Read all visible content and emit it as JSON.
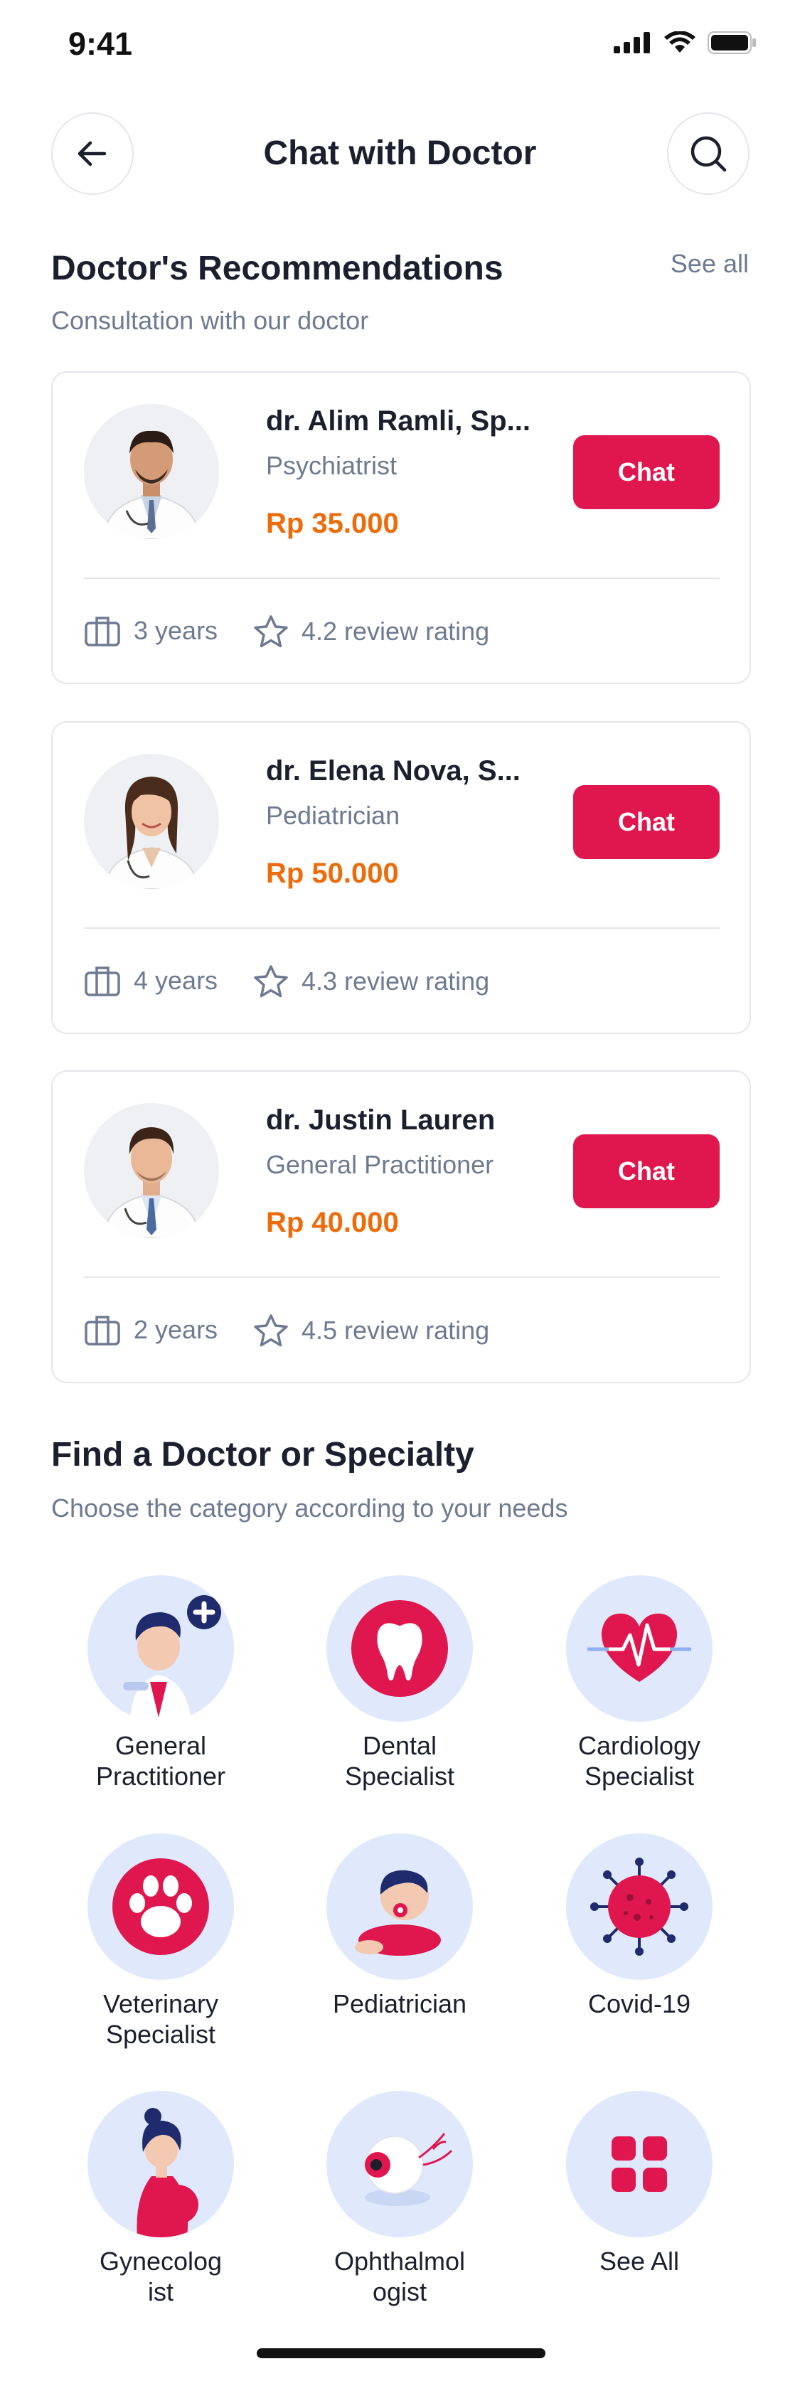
{
  "status_bar": {
    "time": "9:41"
  },
  "header": {
    "title": "Chat with Doctor"
  },
  "recommendations": {
    "title": "Doctor's Recommendations",
    "subtitle": "Consultation with our doctor",
    "see_all": "See all",
    "doctors": [
      {
        "name": "dr. Alim Ramli, Sp...",
        "specialty": "Psychiatrist",
        "price": "Rp 35.000",
        "chat_label": "Chat",
        "experience": "3 years",
        "rating": "4.2 review rating"
      },
      {
        "name": "dr. Elena Nova, S...",
        "specialty": "Pediatrician",
        "price": "Rp 50.000",
        "chat_label": "Chat",
        "experience": "4 years",
        "rating": "4.3 review rating"
      },
      {
        "name": "dr. Justin Lauren",
        "specialty": "General Practitioner",
        "price": "Rp 40.000",
        "chat_label": "Chat",
        "experience": "2 years",
        "rating": "4.5 review rating"
      }
    ]
  },
  "specialty": {
    "title": "Find a Doctor or Specialty",
    "subtitle": "Choose the category according to your needs",
    "categories": [
      {
        "label": "General\nPractitioner",
        "icon": "doctor-icon"
      },
      {
        "label": "Dental\nSpecialist",
        "icon": "tooth-icon"
      },
      {
        "label": "Cardiology\nSpecialist",
        "icon": "heart-icon"
      },
      {
        "label": "Veterinary\nSpecialist",
        "icon": "paw-icon"
      },
      {
        "label": "Pediatrician",
        "icon": "baby-icon"
      },
      {
        "label": "Covid-19",
        "icon": "virus-icon"
      },
      {
        "label": "Gynecolog\nist",
        "icon": "pregnant-icon"
      },
      {
        "label": "Ophthalmol\nogist",
        "icon": "eye-icon"
      },
      {
        "label": "See All",
        "icon": "grid-icon"
      }
    ]
  },
  "colors": {
    "accent": "#e0174e",
    "price": "#ee6b0a",
    "muted": "#6e7a91",
    "category_bg": "#e0e9fb"
  }
}
